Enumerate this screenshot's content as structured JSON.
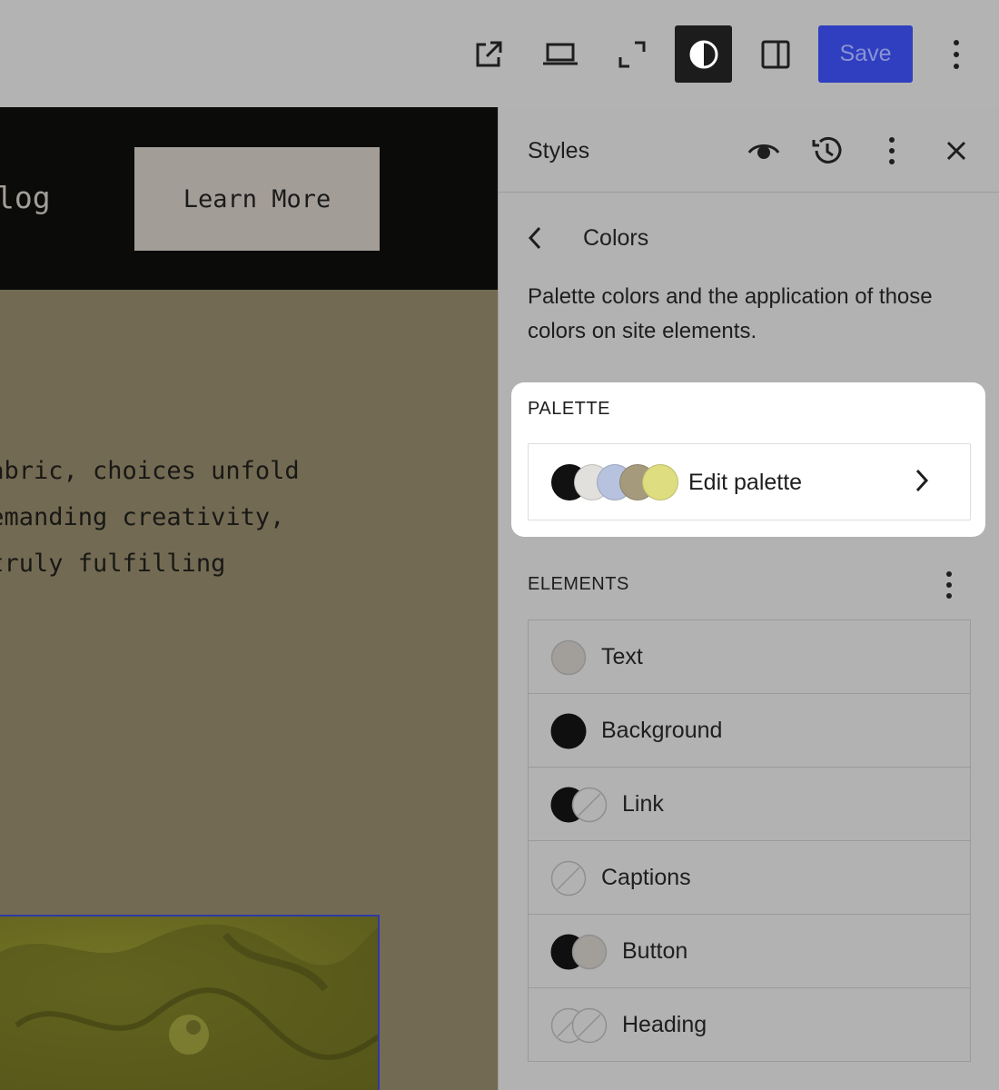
{
  "toolbar": {
    "save_label": "Save",
    "icons": [
      "external-link-icon",
      "laptop-icon",
      "fullscreen-icon",
      "contrast-icon",
      "sidebar-toggle-icon",
      "more-vertical-icon"
    ]
  },
  "canvas": {
    "nav_item": "log",
    "button_label": "Learn More",
    "body_text": "fabric, choices unfold\ndemanding creativity,\n truly fulfilling"
  },
  "sidebar": {
    "title": "Styles",
    "header_icons": [
      "eye-icon",
      "history-icon",
      "more-vertical-icon",
      "close-icon"
    ],
    "back_label": "Colors",
    "description": "Palette colors and the application of those colors on site elements.",
    "palette": {
      "section_label": "PALETTE",
      "edit_label": "Edit palette",
      "swatch_colors": [
        "#111111",
        "#e2e0dd",
        "#b7c2de",
        "#a59a7c",
        "#dedd80"
      ]
    },
    "elements": {
      "section_label": "ELEMENTS",
      "items": [
        {
          "label": "Text"
        },
        {
          "label": "Background"
        },
        {
          "label": "Link"
        },
        {
          "label": "Captions"
        },
        {
          "label": "Button"
        },
        {
          "label": "Heading"
        }
      ]
    }
  },
  "colors": {
    "accent": "#2f3fbf",
    "canvas_bg": "#736a53",
    "header_bg": "#0b0b0a",
    "sidebar_bg": "#b2b2b2"
  }
}
